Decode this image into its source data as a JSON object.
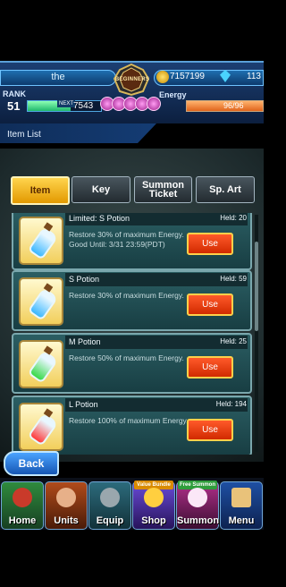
{
  "header": {
    "player_name": "the",
    "crest_label": "BEGINNERS",
    "coins": "7157199",
    "gems": "113",
    "rank_label": "RANK",
    "rank_value": "51",
    "next_label": "NEXT",
    "exp_to_next": "7543",
    "exp_fraction": 0.58,
    "energy_label": "Energy",
    "energy_value": "96/96",
    "energy_fraction": 1.0,
    "orb_count": 5
  },
  "page_title": "Item List",
  "tabs": {
    "item": "Item",
    "key": "Key",
    "summon_ticket": "Summon Ticket",
    "sp_art": "Sp. Art"
  },
  "items": [
    {
      "name": "Limited: S Potion",
      "held": "Held: 20",
      "desc": "Restore 30% of maximum Energy. Good Until: 3/31 23:59(PDT)",
      "use": "Use",
      "color": "#3ab7ff"
    },
    {
      "name": "S Potion",
      "held": "Held: 59",
      "desc": "Restore 30% of maximum Energy.",
      "use": "Use",
      "color": "#3ab7ff"
    },
    {
      "name": "M Potion",
      "held": "Held: 25",
      "desc": "Restore 50% of maximum Energy.",
      "use": "Use",
      "color": "#37d948"
    },
    {
      "name": "L Potion",
      "held": "Held: 194",
      "desc": "Restore 100% of maximum Energy.",
      "use": "Use",
      "color": "#ff3a3a"
    }
  ],
  "back_label": "Back",
  "nav": {
    "home": "Home",
    "units": "Units",
    "equip": "Equip",
    "shop": "Shop",
    "shop_tag": "Value Bundle",
    "summon": "Summon",
    "summon_tag": "Free Summon",
    "menu": "Menu"
  }
}
